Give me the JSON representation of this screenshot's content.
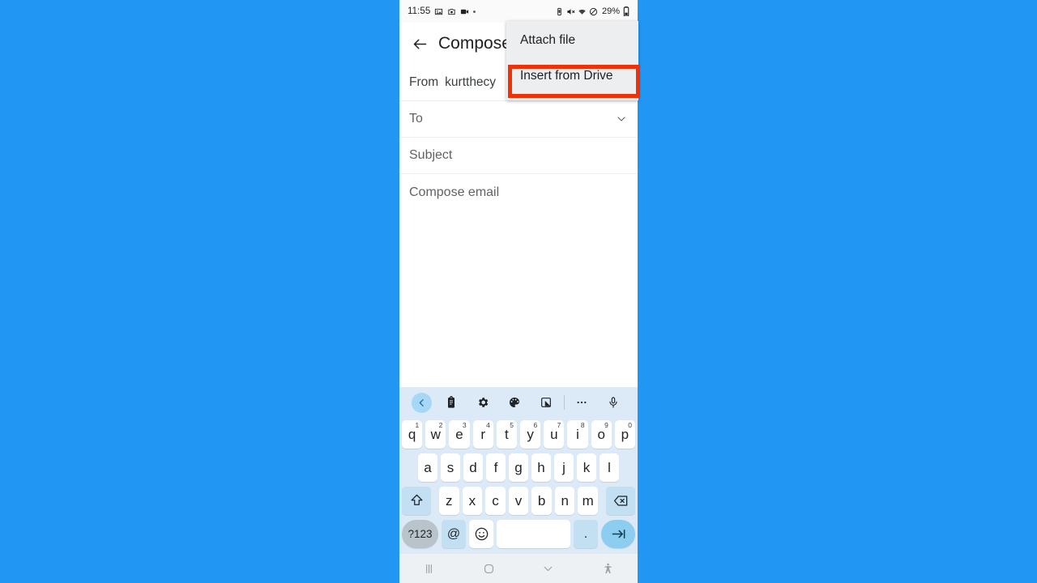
{
  "background_color": "#2196f3",
  "status_bar": {
    "time": "11:55",
    "left_icons": [
      "photos-icon",
      "camera-icon",
      "video-icon",
      "dot-indicator"
    ],
    "right_icons": [
      "vibrate-icon",
      "mute-icon",
      "wifi-icon",
      "do-not-disturb-icon"
    ],
    "battery_percent": "29%",
    "battery_icon": "battery-icon"
  },
  "app_bar": {
    "back_icon": "back-arrow-icon",
    "title": "Compose"
  },
  "compose": {
    "from_label": "From",
    "from_value": "kurtthecy",
    "to_placeholder": "To",
    "to_expand_icon": "chevron-down-icon",
    "subject_placeholder": "Subject",
    "body_placeholder": "Compose email"
  },
  "popup_menu": {
    "items": [
      {
        "label": "Attach file",
        "selected": false
      },
      {
        "label": "Insert from Drive",
        "selected": true
      }
    ],
    "highlight_color": "#f23005",
    "background": "#eceef0"
  },
  "keyboard": {
    "toolbar_icons": [
      "chevron-left-icon",
      "clipboard-icon",
      "settings-gear-icon",
      "palette-icon",
      "resize-keyboard-icon",
      "more-options-icon",
      "microphone-icon"
    ],
    "row1": [
      {
        "key": "q",
        "num": "1"
      },
      {
        "key": "w",
        "num": "2"
      },
      {
        "key": "e",
        "num": "3"
      },
      {
        "key": "r",
        "num": "4"
      },
      {
        "key": "t",
        "num": "5"
      },
      {
        "key": "y",
        "num": "6"
      },
      {
        "key": "u",
        "num": "7"
      },
      {
        "key": "i",
        "num": "8"
      },
      {
        "key": "o",
        "num": "9"
      },
      {
        "key": "p",
        "num": "0"
      }
    ],
    "row2": [
      "a",
      "s",
      "d",
      "f",
      "g",
      "h",
      "j",
      "k",
      "l"
    ],
    "row3": {
      "shift_icon": "shift-key-icon",
      "keys": [
        "z",
        "x",
        "c",
        "v",
        "b",
        "n",
        "m"
      ],
      "delete_icon": "backspace-key-icon"
    },
    "row4": {
      "symbols_label": "?123",
      "at_label": "@",
      "emoji_icon": "emoji-smiley-icon",
      "space_label": "",
      "period_label": ".",
      "enter_icon": "tab-next-field-icon"
    }
  },
  "nav_bar": {
    "recents_icon": "recent-apps-icon",
    "home_icon": "home-icon",
    "hide_keyboard_icon": "hide-keyboard-chevron-icon",
    "accessibility_icon": "accessibility-icon"
  }
}
